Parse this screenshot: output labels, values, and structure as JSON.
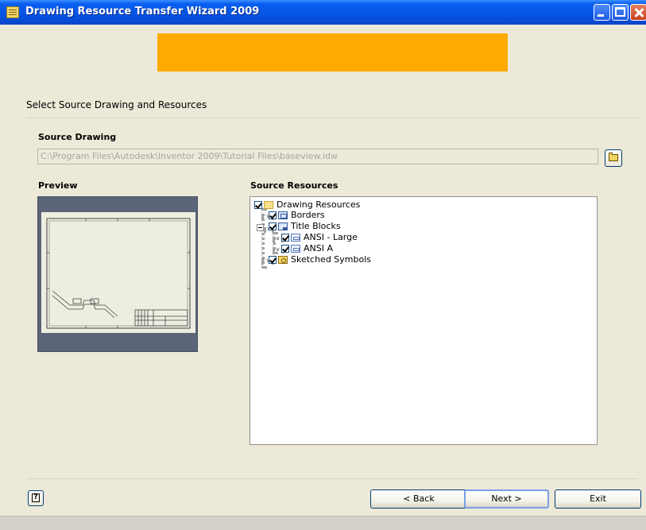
{
  "window": {
    "title": "Drawing Resource Transfer Wizard 2009"
  },
  "banner": {
    "color": "#ffaa00"
  },
  "section_title": "Select Source Drawing and Resources",
  "source_drawing": {
    "label": "Source Drawing",
    "value": "C:\\Program Files\\Autodesk\\Inventor 2009\\Tutorial Files\\baseview.idw",
    "browse_icon": "open-folder-icon"
  },
  "preview": {
    "label": "Preview"
  },
  "source_resources": {
    "label": "Source Resources",
    "tree": [
      {
        "label": "Drawing Resources",
        "checked": true,
        "icon": "folder-icon"
      },
      {
        "label": "Borders",
        "checked": true,
        "icon": "border-icon"
      },
      {
        "label": "Title Blocks",
        "checked": true,
        "icon": "title-block-icon",
        "expanded": true
      },
      {
        "label": "ANSI - Large",
        "checked": true,
        "icon": "sheet-icon"
      },
      {
        "label": "ANSI A",
        "checked": true,
        "icon": "sheet-icon"
      },
      {
        "label": "Sketched Symbols",
        "checked": true,
        "icon": "symbol-icon"
      }
    ]
  },
  "buttons": {
    "back": "< Back",
    "next": "Next >",
    "exit": "Exit",
    "help_icon": "help-icon"
  }
}
